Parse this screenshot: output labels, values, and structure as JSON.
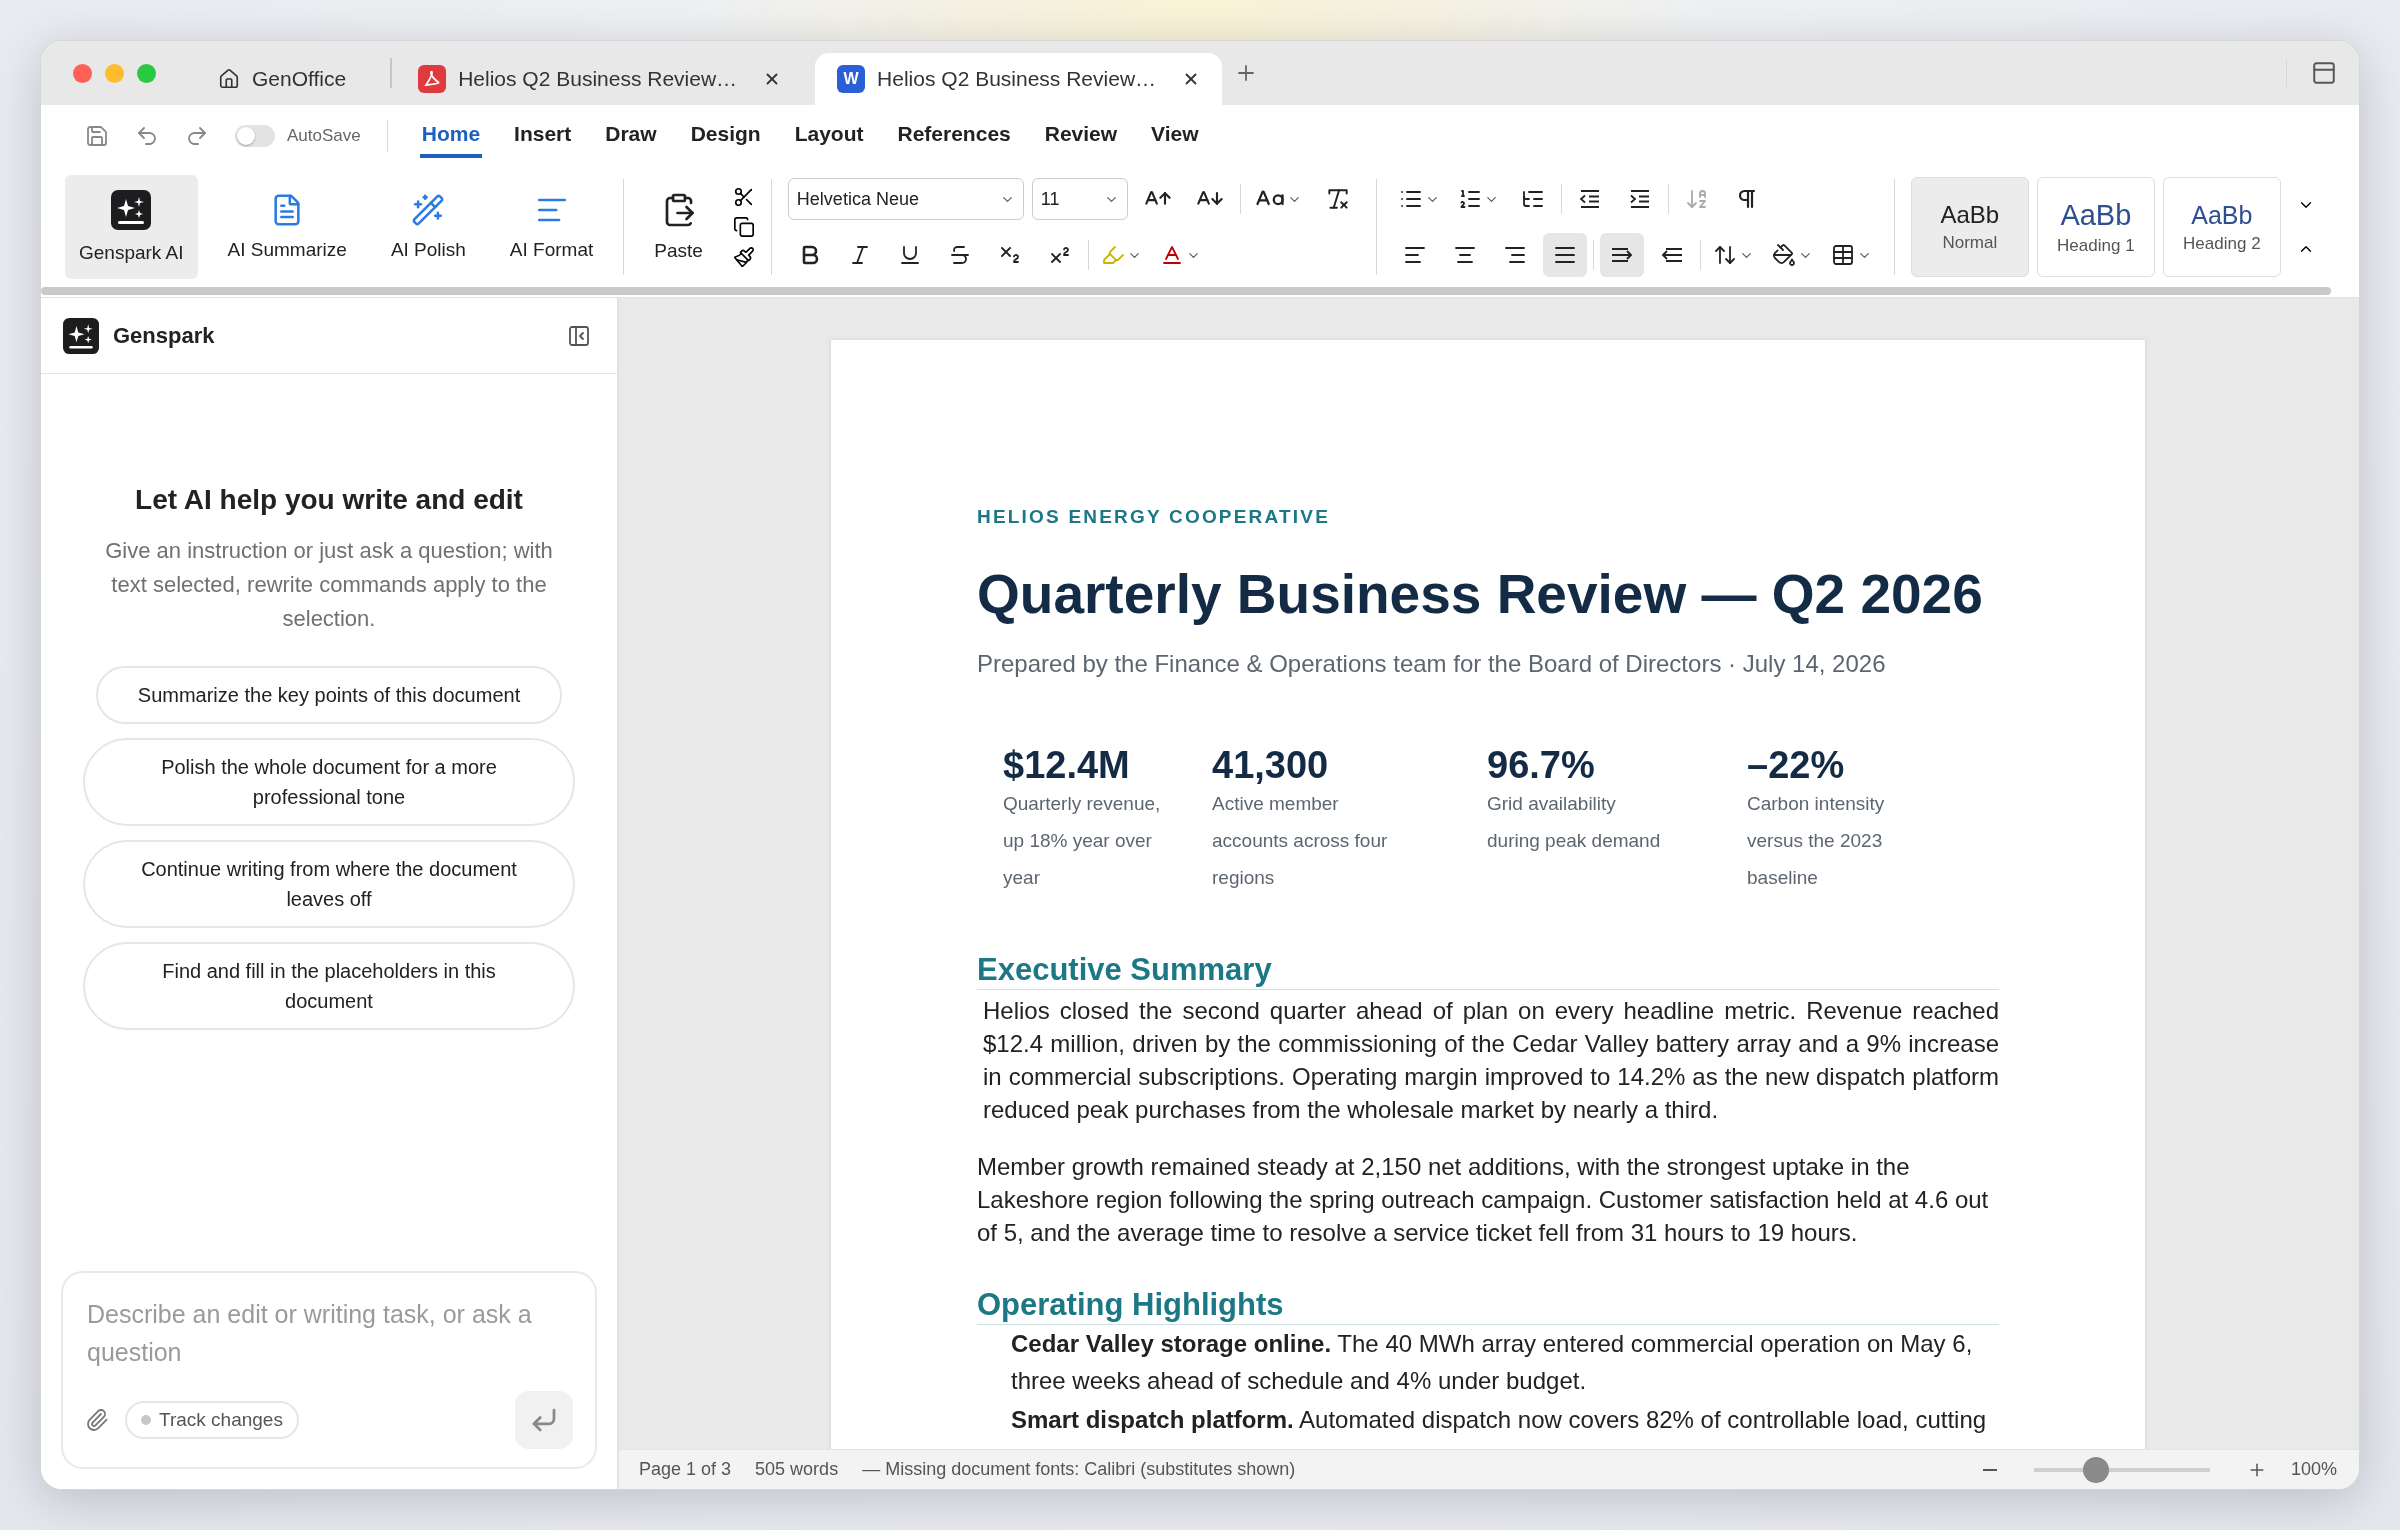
{
  "window_tabs": [
    {
      "label": "GenOffice",
      "kind": "home",
      "selected": false,
      "closable": false
    },
    {
      "label": "Helios Q2 Business Review…",
      "kind": "pdf",
      "selected": false,
      "closable": true
    },
    {
      "label": "Helios Q2 Business Review…",
      "kind": "word",
      "badge": "W",
      "selected": true,
      "closable": true
    }
  ],
  "autosave": {
    "label": "AutoSave",
    "on": false
  },
  "ribbon_tabs": [
    {
      "label": "Home",
      "selected": true
    },
    {
      "label": "Insert",
      "selected": false
    },
    {
      "label": "Draw",
      "selected": false
    },
    {
      "label": "Design",
      "selected": false
    },
    {
      "label": "Layout",
      "selected": false
    },
    {
      "label": "References",
      "selected": false
    },
    {
      "label": "Review",
      "selected": false
    },
    {
      "label": "View",
      "selected": false
    }
  ],
  "ai_buttons": [
    {
      "label": "Genspark AI",
      "kind": "genspark",
      "selected": true
    },
    {
      "label": "AI Summarize",
      "kind": "summarize",
      "selected": false
    },
    {
      "label": "AI Polish",
      "kind": "polish",
      "selected": false
    },
    {
      "label": "AI Format",
      "kind": "format",
      "selected": false
    }
  ],
  "paste": {
    "label": "Paste"
  },
  "font": {
    "value": "Helvetica Neue"
  },
  "font_size": {
    "value": "11"
  },
  "alignment": [
    {
      "kind": "left",
      "selected": false
    },
    {
      "kind": "center",
      "selected": false
    },
    {
      "kind": "right",
      "selected": false
    },
    {
      "kind": "justify",
      "selected": true
    }
  ],
  "direction": [
    {
      "kind": "ltr",
      "selected": true
    },
    {
      "kind": "rtl",
      "selected": false
    }
  ],
  "styles": [
    {
      "preview": "AaBb",
      "label": "Normal",
      "kind": "normal",
      "selected": true
    },
    {
      "preview": "AaBb",
      "label": "Heading 1",
      "kind": "heading1",
      "selected": false
    },
    {
      "preview": "AaBb",
      "label": "Heading 2",
      "kind": "heading2",
      "selected": false
    }
  ],
  "sidebar": {
    "title": "Genspark",
    "heading": "Let AI help you write and edit",
    "description": "Give an instruction or just ask a question; with text selected, rewrite commands apply to the selection.",
    "suggestions": [
      "Summarize the key points of this document",
      "Polish the whole document for a more professional tone",
      "Continue writing from where the document leaves off",
      "Find and fill in the placeholders in this document"
    ],
    "input": {
      "placeholder": "Describe an edit or writing task, or ask a question"
    },
    "track_changes": {
      "label": "Track changes",
      "on": false
    }
  },
  "document": {
    "organization": "HELIOS ENERGY COOPERATIVE",
    "title": "Quarterly Business Review — Q2 2026",
    "subtitle": "Prepared by the Finance & Operations team for the Board of Directors · July 14, 2026",
    "stats": [
      {
        "value": "$12.4M",
        "caption": "Quarterly revenue, up 18% year over year"
      },
      {
        "value": "41,300",
        "caption": "Active member accounts across four regions"
      },
      {
        "value": "96.7%",
        "caption": "Grid availability during peak demand"
      },
      {
        "value": "–22%",
        "caption": "Carbon intensity versus the 2023 baseline"
      }
    ],
    "sections": [
      {
        "heading": "Executive Summary",
        "blocks": [
          {
            "kind": "justified",
            "text": "Helios closed the second quarter ahead of plan on every headline metric. Revenue reached $12.4 million, driven by the commissioning of the Cedar Valley battery array and a 9% increase in commercial subscriptions. Operating margin improved to 14.2% as the new dispatch platform reduced peak purchases from the wholesale market by nearly a third."
          },
          {
            "kind": "plain",
            "text": "Member growth remained steady at 2,150 net additions, with the strongest uptake in the Lakeshore region following the spring outreach campaign. Customer satisfaction held at 4.6 out of 5, and the average time to resolve a service ticket fell from 31 hours to 19 hours."
          }
        ]
      },
      {
        "heading": "Operating Highlights",
        "blocks": [
          {
            "kind": "item",
            "text": "**Cedar Valley storage online.** The 40 MWh array entered commercial operation on May 6, three weeks ahead of schedule and 4% under budget."
          },
          {
            "kind": "item",
            "text": "**Smart dispatch platform.** Automated dispatch now covers 82% of controllable load, cutting"
          }
        ]
      }
    ]
  },
  "status_bar": {
    "page": "Page 1 of 3",
    "words": "505 words",
    "notice": "— Missing document fonts: Calibri (substitutes shown)",
    "zoom": {
      "level": 0.35,
      "reading": "100%"
    }
  }
}
